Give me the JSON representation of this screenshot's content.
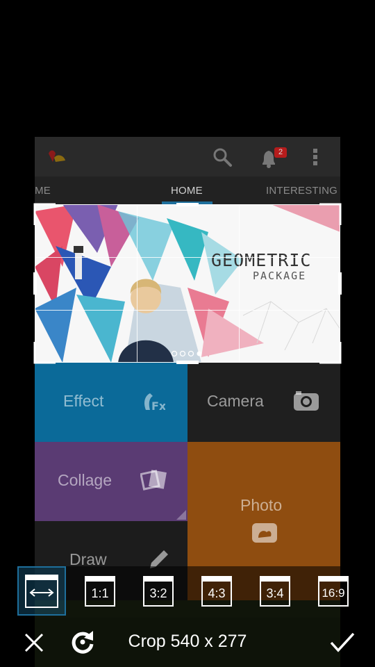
{
  "app_bar": {
    "logo_icon": "app-logo-icon",
    "search_icon": "search-icon",
    "notifications_icon": "bell-icon",
    "notification_count": "2",
    "more_icon": "overflow-menu-icon"
  },
  "tabs": [
    {
      "label": "ME"
    },
    {
      "label": "HOME"
    },
    {
      "label": "INTERESTING"
    }
  ],
  "banner": {
    "title": "GEOMETRIC",
    "subtitle": "PACKAGE"
  },
  "tiles": {
    "effect": {
      "label": "Effect",
      "icon": "fx-icon",
      "color": "#0b6a99"
    },
    "camera": {
      "label": "Camera",
      "icon": "camera-icon",
      "color": "#1f1f1f"
    },
    "collage": {
      "label": "Collage",
      "icon": "collage-icon",
      "color": "#5a3b73"
    },
    "photo": {
      "label": "Photo",
      "icon": "photo-icon",
      "color": "#8f4d10"
    },
    "draw": {
      "label": "Draw",
      "icon": "pencil-icon",
      "color": "#1c1c1c"
    }
  },
  "ratios": [
    {
      "label": "",
      "icon": "free-ratio-icon",
      "selected": true
    },
    {
      "label": "1:1"
    },
    {
      "label": "3:2"
    },
    {
      "label": "4:3"
    },
    {
      "label": "3:4"
    },
    {
      "label": "16:9"
    }
  ],
  "actions": {
    "cancel_icon": "close-icon",
    "reset_icon": "rotate-reset-icon",
    "crop_label": "Crop 540 x 277",
    "confirm_icon": "check-icon"
  },
  "colors": {
    "accent": "#1e6f9c",
    "badge": "#b51c1c"
  }
}
